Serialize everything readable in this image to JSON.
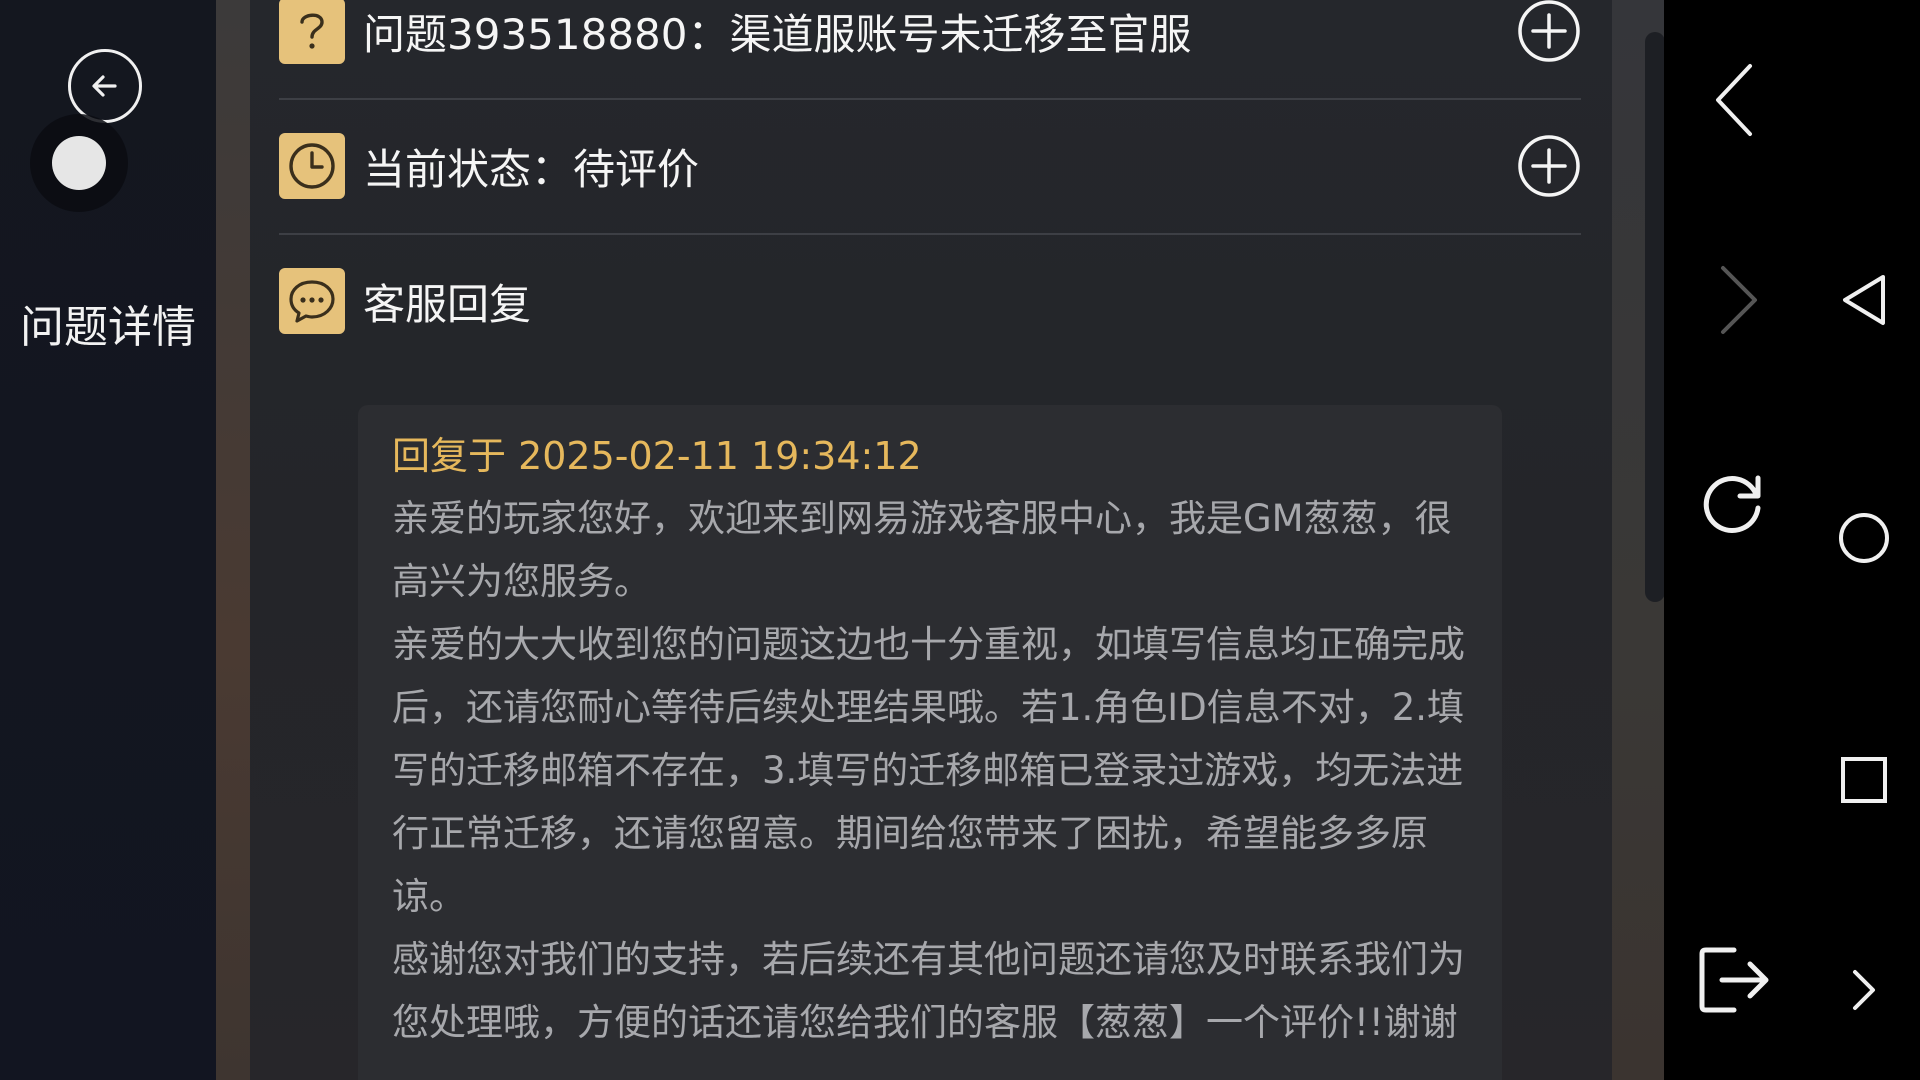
{
  "sidebar": {
    "title": "问题详情"
  },
  "ticket": {
    "question": "问题393518880：渠道服账号未迁移至官服",
    "status": "当前状态：待评价",
    "reply_section_title": "客服回复"
  },
  "reply": {
    "time": "回复于 2025-02-11 19:34:12",
    "paragraphs": [
      "亲爱的玩家您好，欢迎来到网易游戏客服中心，我是GM葱葱，很高兴为您服务。",
      "亲爱的大大收到您的问题这边也十分重视，如填写信息均正确完成后，还请您耐心等待后续处理结果哦。若1.角色ID信息不对，2.填写的迁移邮箱不存在，3.填写的迁移邮箱已登录过游戏，均无法进行正常迁移，还请您留意。期间给您带来了困扰，希望能多多原谅。",
      "感谢您对我们的支持，若后续还有其他问题还请您及时联系我们为您处理哦，方便的话还请您给我们的客服【葱葱】一个评价!!谢谢"
    ]
  },
  "colors": {
    "accent": "#e6c27b",
    "reply_time": "#e6b85c",
    "body_text": "#a7a8ac"
  },
  "icons": {
    "back": "arrow-left-circle-icon",
    "question": "question-mark-icon",
    "clock": "clock-icon",
    "chat": "chat-bubble-icon",
    "expand": "plus-circle-icon",
    "browser_back": "chevron-left-icon",
    "browser_forward": "chevron-right-icon",
    "reload": "reload-icon",
    "exit": "exit-icon",
    "nav_back": "triangle-back-icon",
    "nav_home": "circle-home-icon",
    "nav_recent": "square-recent-icon",
    "nav_expand": "chevron-right-small-icon"
  }
}
